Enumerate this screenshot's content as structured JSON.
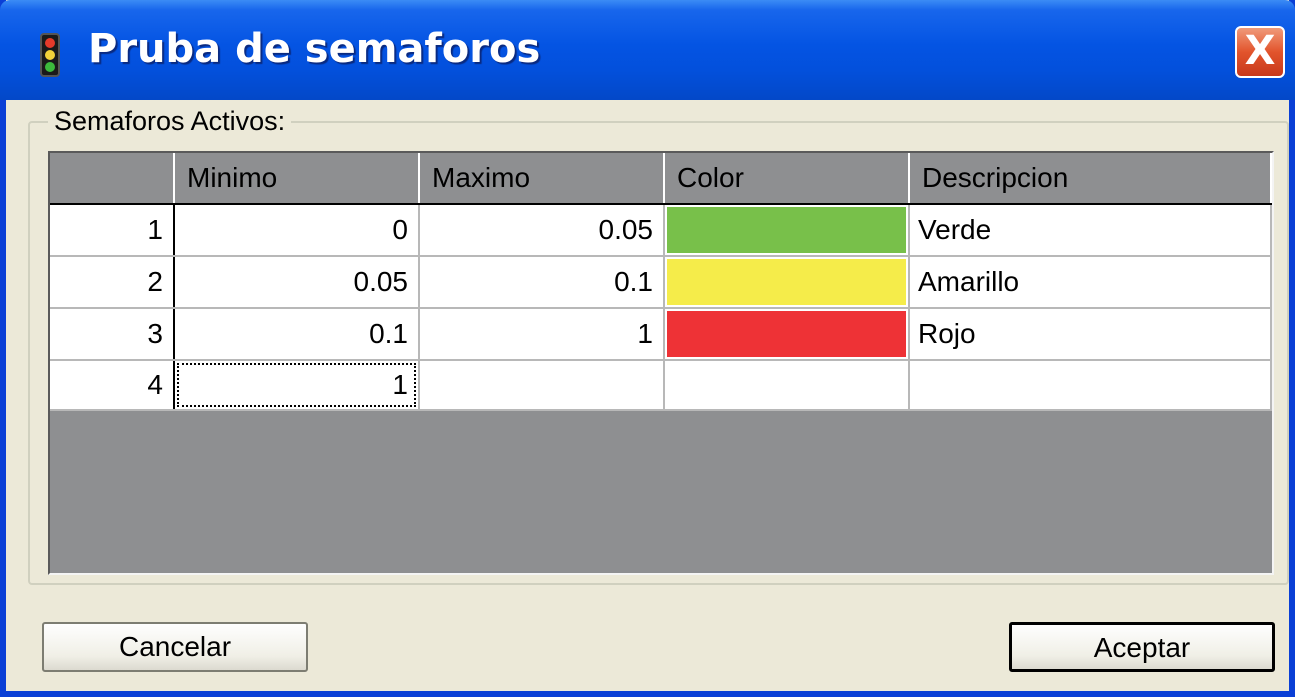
{
  "window": {
    "title": "Pruba de semaforos",
    "close_label": "X"
  },
  "group": {
    "label": "Semaforos Activos:"
  },
  "grid": {
    "columns": [
      "Minimo",
      "Maximo",
      "Color",
      "Descripcion"
    ],
    "rows": [
      {
        "row": "1",
        "minimo": "0",
        "maximo": "0.05",
        "color": "#78c04a",
        "descripcion": "Verde"
      },
      {
        "row": "2",
        "minimo": "0.05",
        "maximo": "0.1",
        "color": "#f5ec4a",
        "descripcion": "Amarillo"
      },
      {
        "row": "3",
        "minimo": "0.1",
        "maximo": "1",
        "color": "#ee3236",
        "descripcion": "Rojo"
      },
      {
        "row": "4",
        "minimo": "1",
        "maximo": "",
        "color": "#ffffff",
        "descripcion": ""
      }
    ]
  },
  "buttons": {
    "cancel_label": "Cancelar",
    "accept_label": "Aceptar"
  },
  "icons": {
    "title_icon": "traffic-light-icon",
    "close_icon": "close-icon"
  },
  "colors": {
    "titlebar": "#0454e3",
    "window_bg": "#ece9d8",
    "grid_bg": "#8e8f91"
  }
}
